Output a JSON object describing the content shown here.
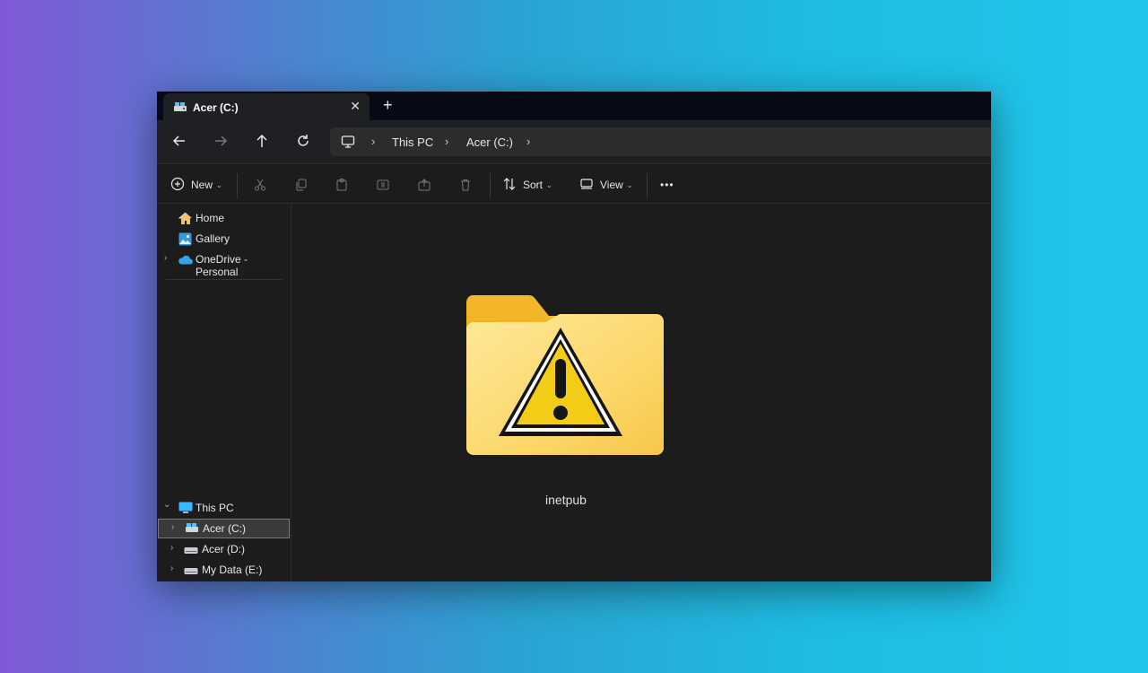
{
  "tab": {
    "title": "Acer (C:)",
    "close": "✕",
    "new_tab": "+"
  },
  "address": {
    "crumbs": [
      "This PC",
      "Acer (C:)"
    ],
    "separator": "›"
  },
  "toolbar": {
    "new_label": "New",
    "sort_label": "Sort",
    "view_label": "View",
    "more": "•••",
    "caret": "⌄"
  },
  "sidebar": {
    "quick": [
      {
        "label": "Home",
        "icon": "home-icon"
      },
      {
        "label": "Gallery",
        "icon": "gallery-icon"
      },
      {
        "label": "OneDrive - Personal",
        "icon": "cloud-icon"
      }
    ],
    "this_pc": {
      "label": "This PC",
      "icon": "monitor-icon"
    },
    "drives": [
      {
        "label": "Acer (C:)",
        "icon": "drive-icon",
        "selected": true
      },
      {
        "label": "Acer (D:)",
        "icon": "drive-icon",
        "selected": false
      },
      {
        "label": "My Data (E:)",
        "icon": "drive-icon",
        "selected": false
      }
    ],
    "chev_right": "›",
    "chev_down": "⌄"
  },
  "content": {
    "items": [
      {
        "name": "inetpub",
        "icon": "warning-folder-icon"
      }
    ]
  },
  "colors": {
    "accent": "#4cc2ff",
    "folder_yellow": "#f5c84a",
    "warning_yellow": "#f2cc17"
  }
}
